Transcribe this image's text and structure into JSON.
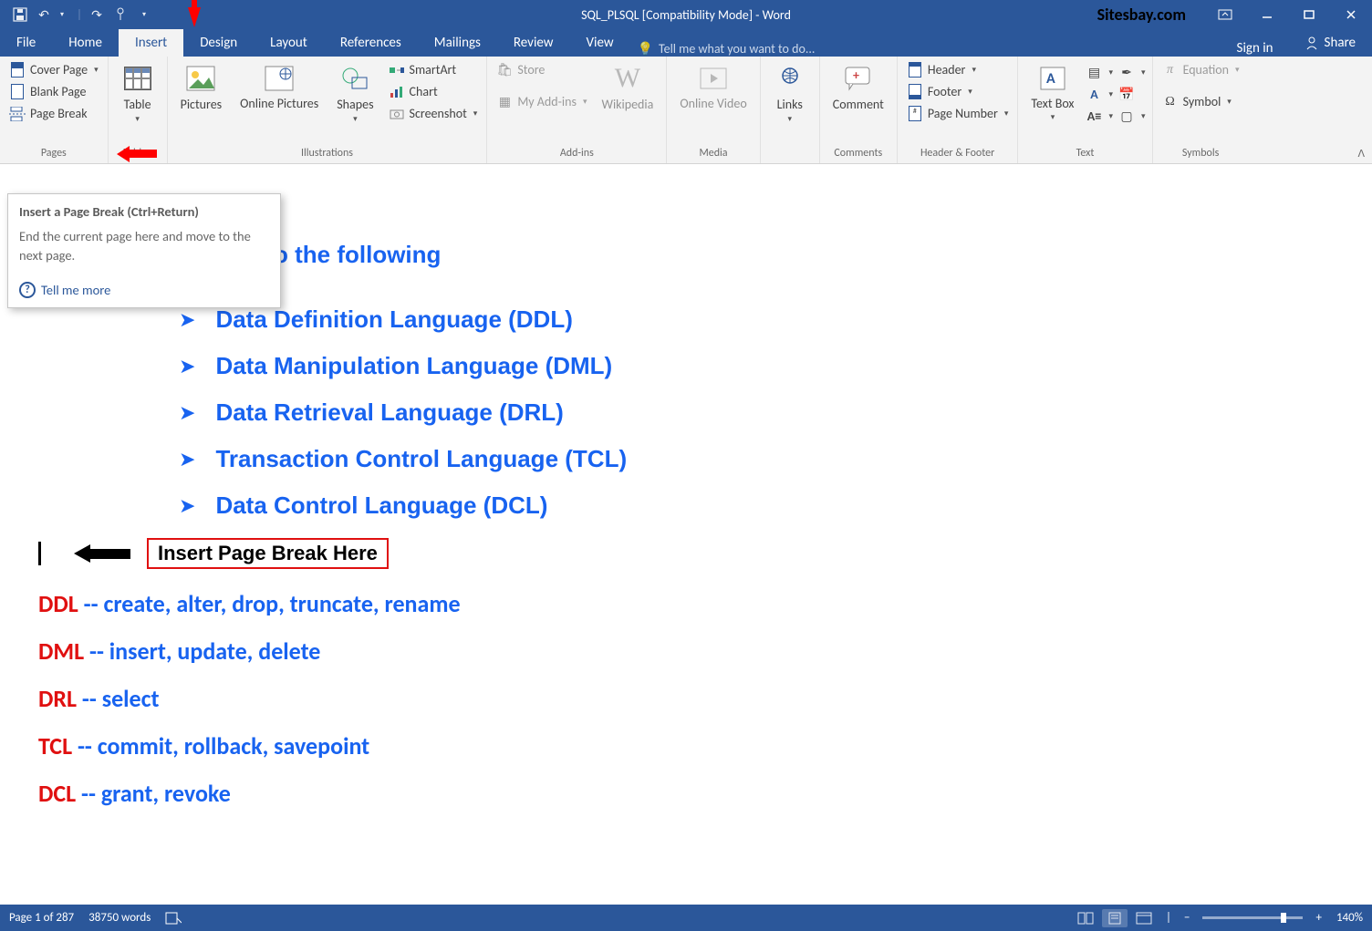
{
  "titlebar": {
    "title": "SQL_PLSQL [Compatibility Mode] - Word",
    "watermark": "Sitesbay.com"
  },
  "tabs": {
    "file": "File",
    "home": "Home",
    "insert": "Insert",
    "design": "Design",
    "layout": "Layout",
    "references": "References",
    "mailings": "Mailings",
    "review": "Review",
    "view": "View",
    "tellme": "Tell me what you want to do...",
    "signin": "Sign in",
    "share": "Share"
  },
  "ribbon": {
    "pages": {
      "label": "Pages",
      "cover": "Cover Page",
      "blank": "Blank Page",
      "break": "Page Break"
    },
    "tables": {
      "label": "Tables",
      "table": "Table"
    },
    "illustrations": {
      "label": "Illustrations",
      "pictures": "Pictures",
      "online_pictures": "Online Pictures",
      "shapes": "Shapes",
      "smartart": "SmartArt",
      "chart": "Chart",
      "screenshot": "Screenshot"
    },
    "addins": {
      "label": "Add-ins",
      "store": "Store",
      "myaddins": "My Add-ins",
      "wikipedia": "Wikipedia"
    },
    "media": {
      "label": "Media",
      "video": "Online Video"
    },
    "links": {
      "label": "",
      "links": "Links"
    },
    "comments": {
      "label": "Comments",
      "comment": "Comment"
    },
    "headerfooter": {
      "label": "Header & Footer",
      "header": "Header",
      "footer": "Footer",
      "pagenum": "Page Number"
    },
    "text": {
      "label": "Text",
      "textbox": "Text Box"
    },
    "symbols": {
      "label": "Symbols",
      "equation": "Equation",
      "symbol": "Symbol"
    }
  },
  "tooltip": {
    "title": "Insert a Page Break (Ctrl+Return)",
    "body": "End the current page here and move to the next page.",
    "more": "Tell me more"
  },
  "document": {
    "heading_fragment": "o the following",
    "bullets": [
      "Data Definition Language (DDL)",
      "Data Manipulation Language (DML)",
      "Data Retrieval Language (DRL)",
      "Transaction Control Language (TCL)",
      "Data Control Language (DCL)"
    ],
    "annotation": "Insert Page Break Here",
    "defs": [
      {
        "abbr": "DDL",
        "rest": " -- create, alter, drop, truncate, rename"
      },
      {
        "abbr": "DML",
        "rest": " -- insert, update, delete"
      },
      {
        "abbr": "DRL",
        "rest": " -- select"
      },
      {
        "abbr": "TCL",
        "rest": " -- commit, rollback, savepoint"
      },
      {
        "abbr": "DCL",
        "rest": " -- grant, revoke"
      }
    ]
  },
  "statusbar": {
    "page": "Page 1 of 287",
    "words": "38750 words",
    "zoom": "140%"
  }
}
